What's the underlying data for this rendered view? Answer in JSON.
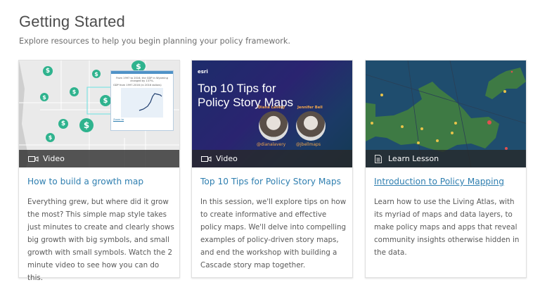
{
  "header": {
    "title": "Getting Started",
    "subtitle": "Explore resources to help you begin planning your policy framework."
  },
  "cards": [
    {
      "type": "Video",
      "icon": "video-camera-icon",
      "title": "How to build a growth map",
      "body": "Everything grew, but where did it grow the most? This simple map style takes just minutes to create and clearly shows big growth with big symbols, and small growth with small symbols. Watch the 2 minute video to see how you can do this.",
      "popup": {
        "text": "From 1997 to 2016, the GDP in Wyoming changed by 137%.",
        "chart_title": "GDP from 1997-2016 (in 2016 dollars)",
        "link": "Zoom to"
      }
    },
    {
      "type": "Video",
      "icon": "video-camera-icon",
      "title": "Top 10 Tips for Policy Story Maps",
      "body": "In this session, we'll explore tips on how to create informative and effective policy maps. We'll delve into compelling examples of policy-driven story maps, and end the workshop with building a Cascade story map together.",
      "thumb": {
        "brand": "esri",
        "headline": "Top 10 Tips for Policy Story Maps",
        "speakers": [
          {
            "name": "Diana Lavery",
            "handle": "@dianalavery"
          },
          {
            "name": "Jennifer Bell",
            "handle": "@jbellmaps"
          }
        ]
      }
    },
    {
      "type": "Learn Lesson",
      "icon": "document-icon",
      "title": "Introduction to Policy Mapping",
      "body": "Learn how to use the Living Atlas, with its myriad of maps and data layers, to make policy maps and apps that reveal community insights otherwise hidden in the data."
    }
  ],
  "colors": {
    "link": "#2f7fb0",
    "accent": "#2fb38e"
  }
}
